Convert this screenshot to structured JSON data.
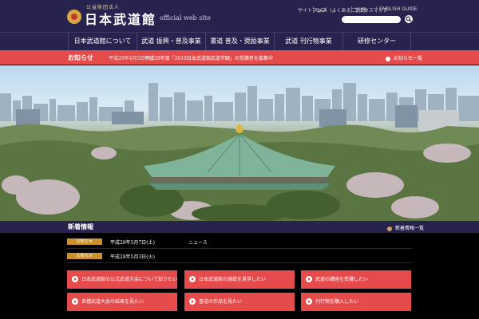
{
  "header": {
    "logo_sub": "公益財団法人",
    "logo_title": "日本武道館",
    "logo_tag": "official web site",
    "util_links": [
      "サイトマップ",
      "Q&A（よくあるご質問）",
      "アクセスマップ",
      "ENGLISH GUIDE"
    ],
    "search_placeholder": ""
  },
  "nav": [
    "日本武道館について",
    "武道 振興・普及事業",
    "書道 普及・奨励事業",
    "武道 刊行物事業",
    "研修センター"
  ],
  "newsbar": {
    "label": "お知らせ",
    "date": "平成28年4月5日(火)",
    "text": "平成28年度「2016日本武道館武道学園」の受講者を募集中",
    "link": "お知らせ一覧"
  },
  "section": {
    "title": "新着情報",
    "link": "新着情報一覧"
  },
  "news_rows": [
    {
      "badge": "お知らせ",
      "date": "平成28年5月7日(土)",
      "text": "ニュース"
    },
    {
      "badge": "お知らせ",
      "date": "平成28年5月3日(火)",
      "text": ""
    }
  ],
  "nav_buttons": [
    "日本武道館の公式武道大会について知りたい",
    "日本武道館の施設を見学したい",
    "武道の講座を受講したい",
    "各種武道大会の結果を見たい",
    "書道の作品を見たい",
    "刊行物を購入したい"
  ],
  "colors": {
    "navy": "#27234e",
    "red": "#e64b4b",
    "gold": "#c9922e"
  }
}
